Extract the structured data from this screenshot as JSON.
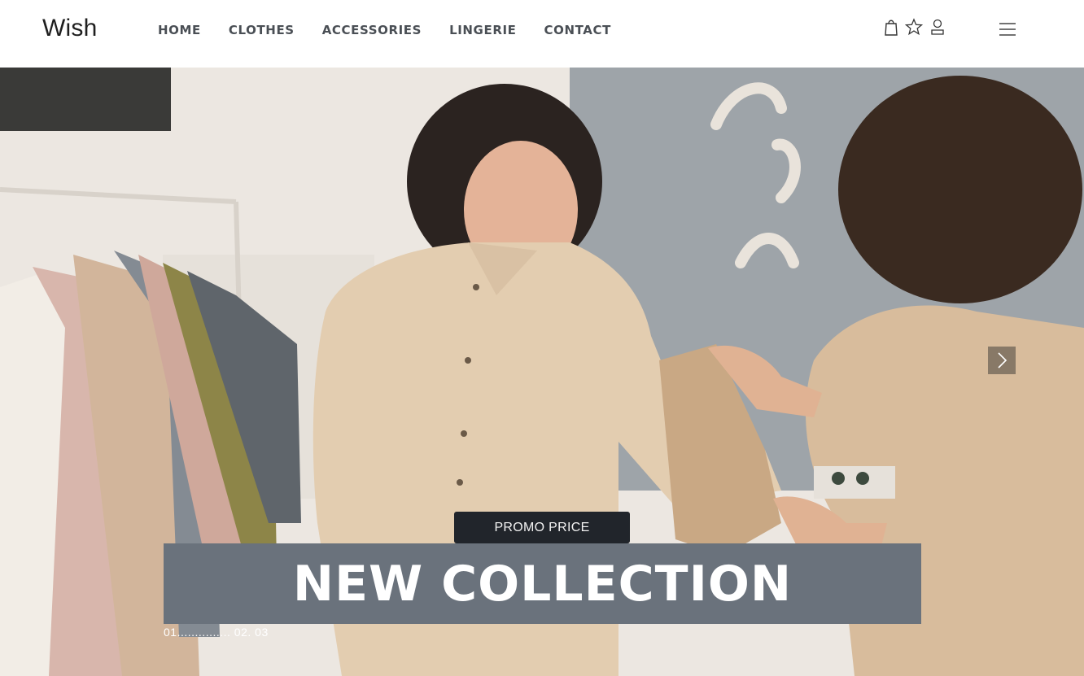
{
  "header": {
    "logo": "Wish",
    "nav": [
      {
        "label": "HOME"
      },
      {
        "label": "CLOTHES"
      },
      {
        "label": "ACCESSORIES"
      },
      {
        "label": "LINGERIE"
      },
      {
        "label": "CONTACT"
      }
    ],
    "icons": [
      "shopping-bag-icon",
      "star-icon",
      "user-icon",
      "hamburger-menu-icon"
    ]
  },
  "hero": {
    "promo_label": "PROMO PRICE",
    "headline": "NEW COLLECTION",
    "pager": "01............... 02. 03",
    "next_icon": "chevron-right-icon",
    "colors": {
      "banner": "#6a727c",
      "promo": "#21252b",
      "shirt": "#e3cdb0",
      "wall": "#9aa0a6"
    }
  }
}
